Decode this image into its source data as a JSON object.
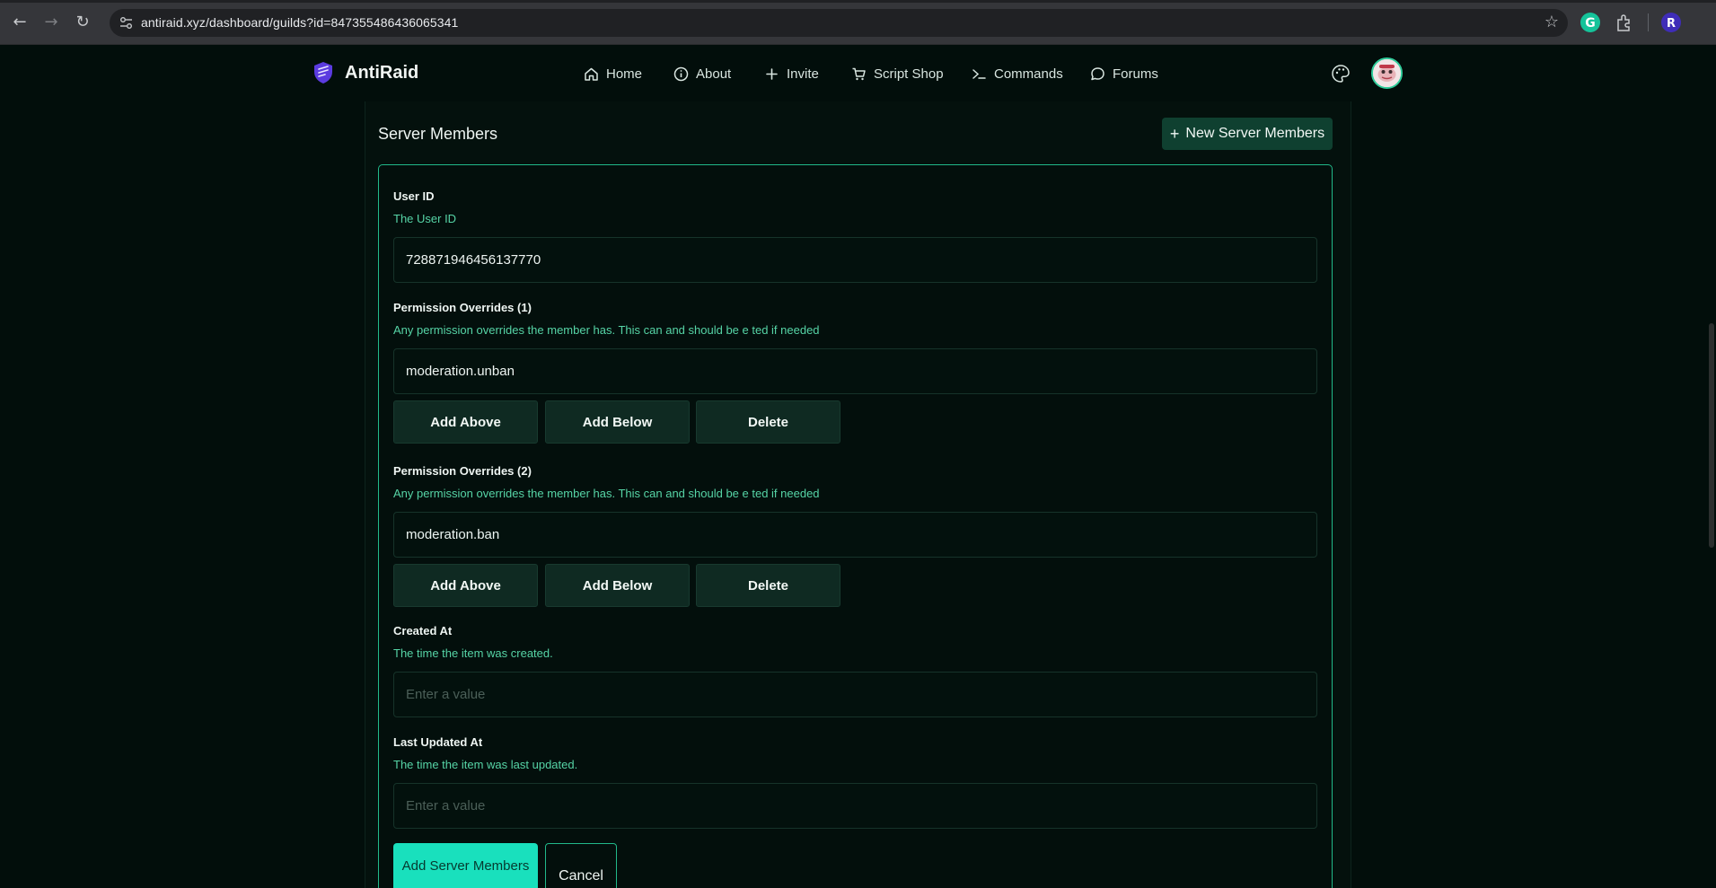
{
  "browser": {
    "url": "antiraid.xyz/dashboard/guilds?id=847355486436065341",
    "icons": [
      "back-icon",
      "forward-icon",
      "reload-icon",
      "site-settings-icon",
      "bookmark-star-icon",
      "grammarly-icon",
      "extensions-icon",
      "profile-icon"
    ]
  },
  "header": {
    "brand": "AntiRaid",
    "nav": [
      {
        "label": "Home",
        "icon": "home-icon"
      },
      {
        "label": "About",
        "icon": "info-icon"
      },
      {
        "label": "Invite",
        "icon": "plus-icon"
      },
      {
        "label": "Script Shop",
        "icon": "cart-icon"
      },
      {
        "label": "Commands",
        "icon": "terminal-icon"
      },
      {
        "label": "Forums",
        "icon": "chat-icon"
      }
    ]
  },
  "section": {
    "title": "Server Members",
    "new_button": "New Server Members"
  },
  "form": {
    "user_id": {
      "label": "User ID",
      "description": "The User ID",
      "value": "728871946456137770"
    },
    "overrides": [
      {
        "label": "Permission Overrides (1)",
        "description": "Any permission overrides the member has. This can and should be e ted if needed",
        "value": "moderation.unban"
      },
      {
        "label": "Permission Overrides (2)",
        "description": "Any permission overrides the member has. This can and should be e ted if needed",
        "value": "moderation.ban"
      }
    ],
    "row_actions": {
      "add_above": "Add Above",
      "add_below": "Add Below",
      "delete": "Delete"
    },
    "created_at": {
      "label": "Created At",
      "description": "The time the item was created.",
      "placeholder": "Enter a value"
    },
    "last_updated_at": {
      "label": "Last Updated At",
      "description": "The time the item was last updated.",
      "placeholder": "Enter a value"
    },
    "submit_label": "Add Server Members",
    "cancel_label": "Cancel"
  },
  "colors": {
    "background": "#020e0b",
    "accent": "#19e0bd",
    "border_accent": "#21b98a",
    "description_text": "#56d4a6"
  }
}
